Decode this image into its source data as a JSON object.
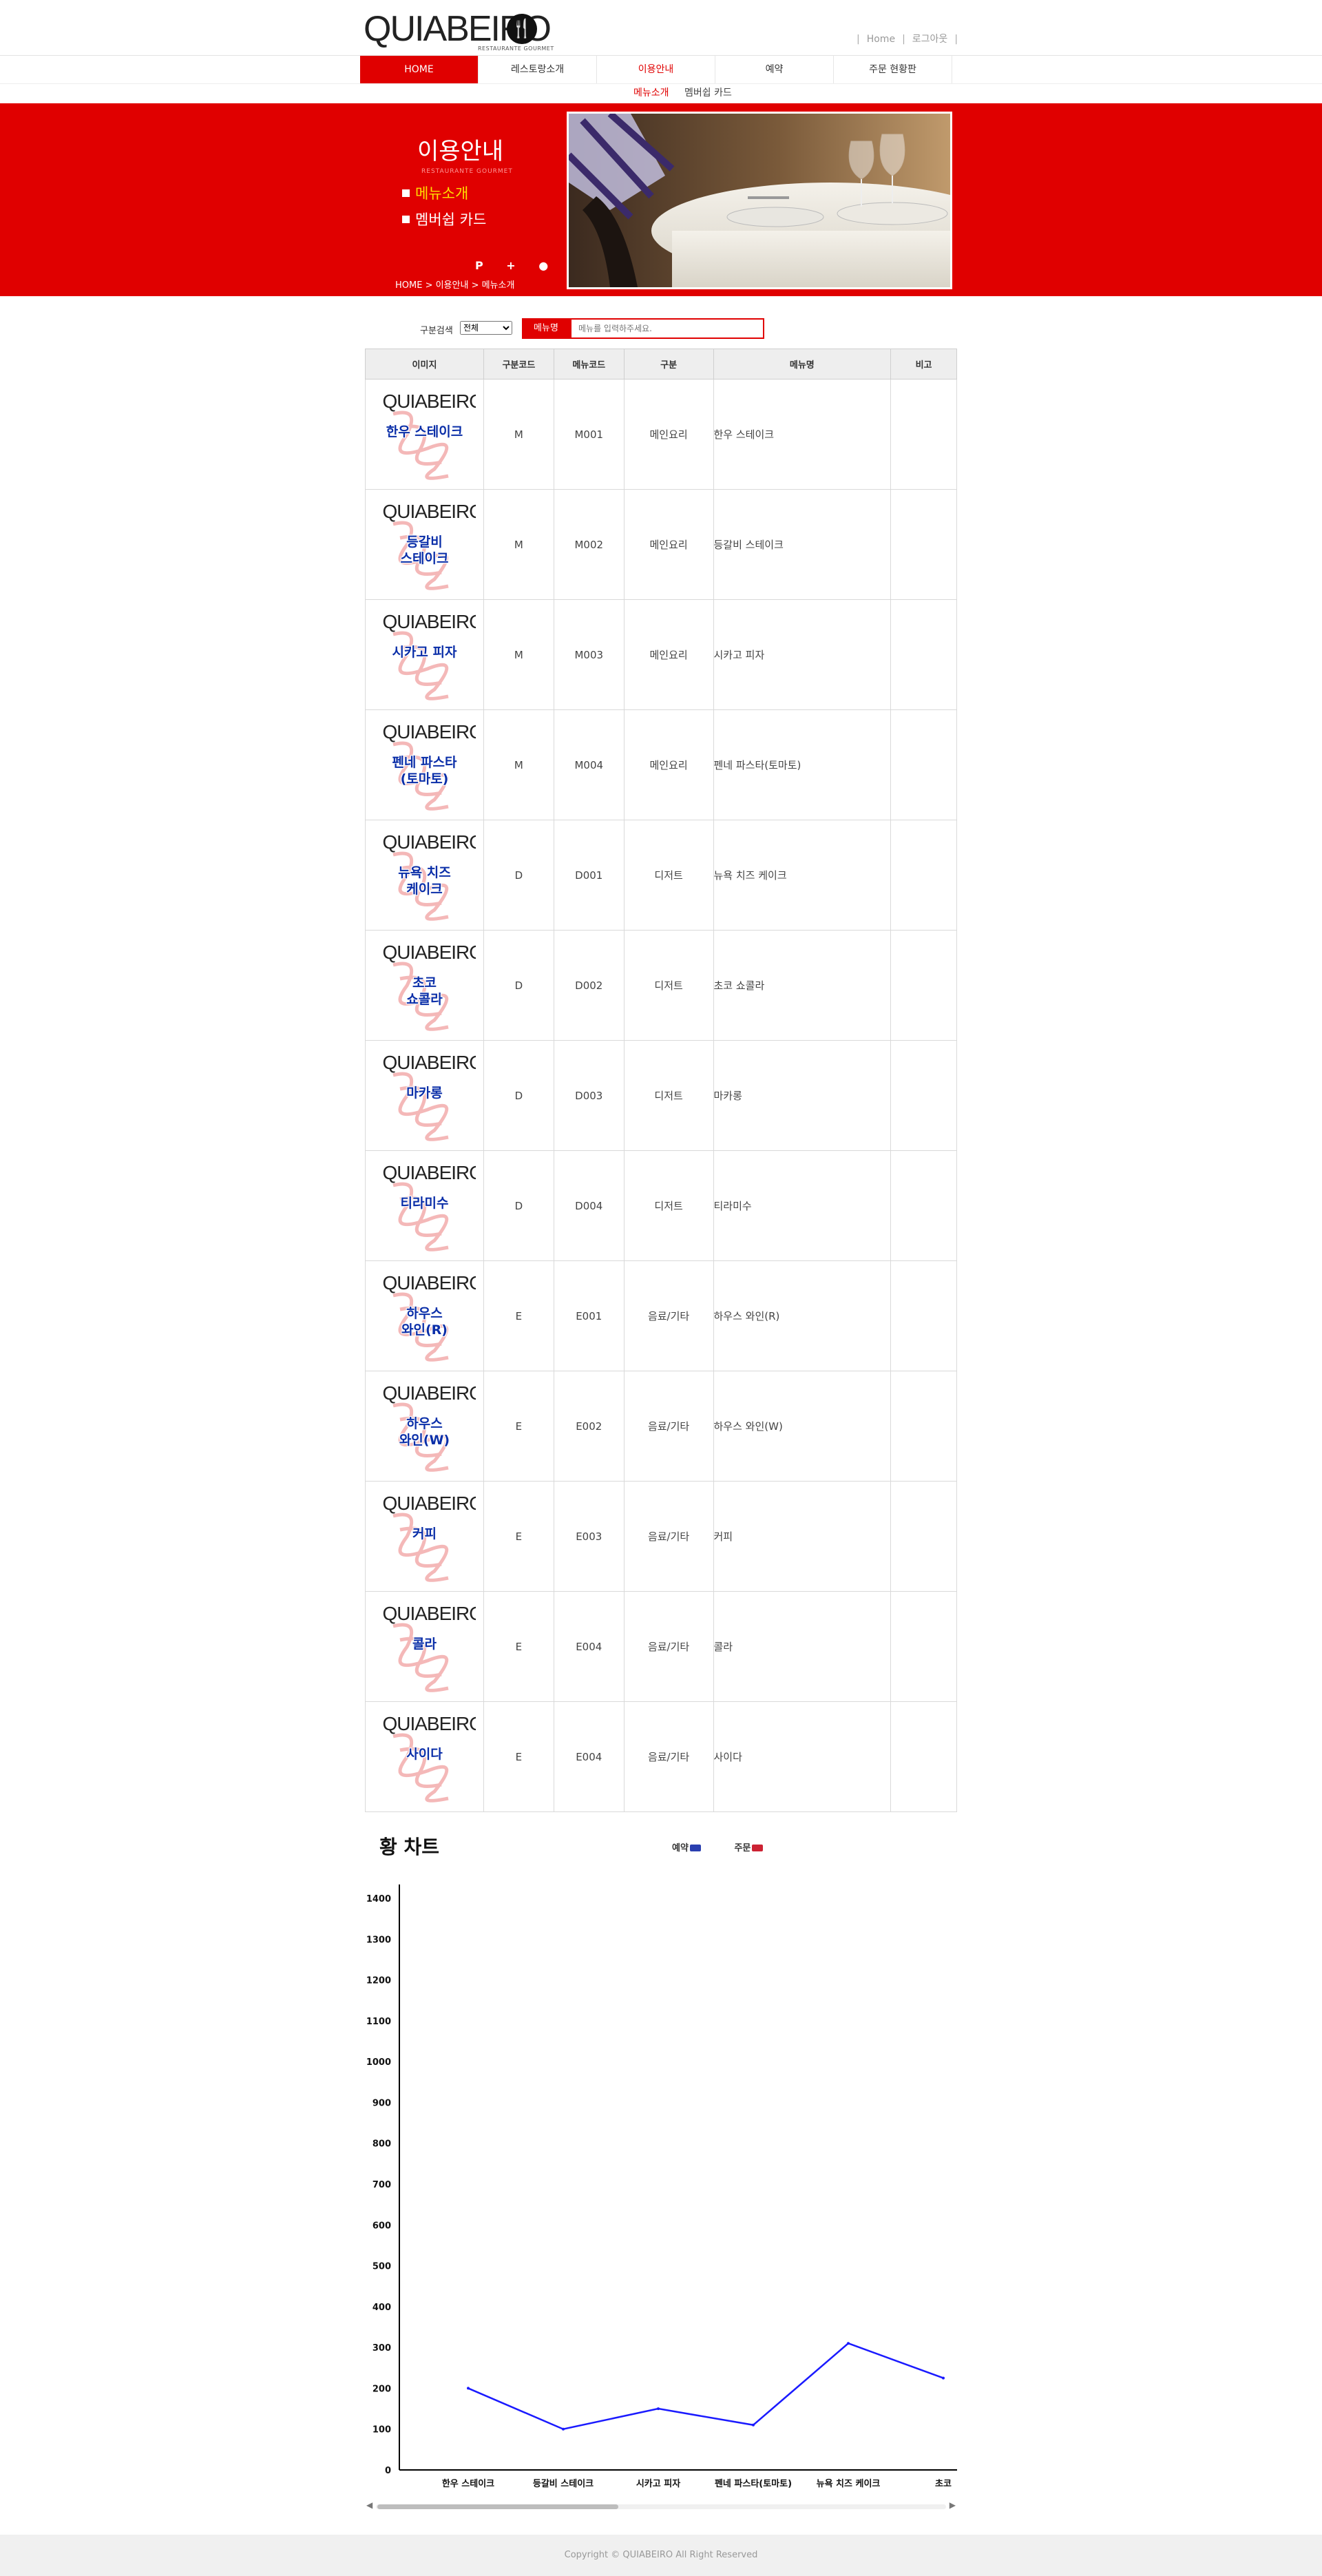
{
  "header": {
    "logo_text": "QUIABEIRO",
    "logo_sub": "RESTAURANTE GOURMET",
    "util_home": "Home",
    "util_login": "로그아웃"
  },
  "gnb": [
    "HOME",
    "레스토랑소개",
    "이용안내",
    "예약",
    "주문 현황판"
  ],
  "subnav": [
    "메뉴소개",
    "멤버쉽 카드"
  ],
  "hero": {
    "title": "이용안내",
    "subtitle": "RESTAURANTE GOURMET",
    "menu": [
      "메뉴소개",
      "멤버쉽 카드"
    ],
    "slider_controls": "P + ● −",
    "breadcrumb": "HOME > 이용안내 > 메뉴소개"
  },
  "search": {
    "label": "구분검색",
    "select_value": "전체",
    "field_label": "메뉴명",
    "placeholder": "메뉴를 입력하주세요."
  },
  "table": {
    "headers": [
      "이미지",
      "구분코드",
      "메뉴코드",
      "구분",
      "메뉴명",
      "비고"
    ],
    "rows": [
      {
        "img_label": "한우 스테이크",
        "type_code": "M",
        "menu_code": "M001",
        "category": "메인요리",
        "name": "한우 스테이크",
        "note": ""
      },
      {
        "img_label": "등갈비\n스테이크",
        "type_code": "M",
        "menu_code": "M002",
        "category": "메인요리",
        "name": "등갈비 스테이크",
        "note": ""
      },
      {
        "img_label": "시카고 피자",
        "type_code": "M",
        "menu_code": "M003",
        "category": "메인요리",
        "name": "시카고 피자",
        "note": ""
      },
      {
        "img_label": "펜네 파스타\n(토마토)",
        "type_code": "M",
        "menu_code": "M004",
        "category": "메인요리",
        "name": "펜네 파스타(토마토)",
        "note": ""
      },
      {
        "img_label": "뉴욕 치즈\n케이크",
        "type_code": "D",
        "menu_code": "D001",
        "category": "디저트",
        "name": "뉴욕 치즈 케이크",
        "note": ""
      },
      {
        "img_label": "초코\n쇼콜라",
        "type_code": "D",
        "menu_code": "D002",
        "category": "디저트",
        "name": "초코 쇼콜라",
        "note": ""
      },
      {
        "img_label": "마카롱",
        "type_code": "D",
        "menu_code": "D003",
        "category": "디저트",
        "name": "마카롱",
        "note": ""
      },
      {
        "img_label": "티라미수",
        "type_code": "D",
        "menu_code": "D004",
        "category": "디저트",
        "name": "티라미수",
        "note": ""
      },
      {
        "img_label": "하우스\n와인(R)",
        "type_code": "E",
        "menu_code": "E001",
        "category": "음료/기타",
        "name": "하우스 와인(R)",
        "note": ""
      },
      {
        "img_label": "하우스\n와인(W)",
        "type_code": "E",
        "menu_code": "E002",
        "category": "음료/기타",
        "name": "하우스 와인(W)",
        "note": ""
      },
      {
        "img_label": "커피",
        "type_code": "E",
        "menu_code": "E003",
        "category": "음료/기타",
        "name": "커피",
        "note": ""
      },
      {
        "img_label": "콜라",
        "type_code": "E",
        "menu_code": "E004",
        "category": "음료/기타",
        "name": "콜라",
        "note": ""
      },
      {
        "img_label": "사이다",
        "type_code": "E",
        "menu_code": "E004",
        "category": "음료/기타",
        "name": "사이다",
        "note": ""
      }
    ]
  },
  "chart_data": {
    "type": "line",
    "title": "황 차트",
    "legend": [
      "예약",
      "주문"
    ],
    "legend_colors": [
      "#2a3fb0",
      "#cc2233"
    ],
    "categories": [
      "한우 스테이크",
      "등갈비 스테이크",
      "시카고 피자",
      "펜네 파스타(토마토)",
      "뉴욕 치즈 케이크",
      "초코"
    ],
    "series": [
      {
        "name": "예약",
        "color": "#1a1aff",
        "values": [
          200,
          100,
          150,
          110,
          310,
          225
        ]
      }
    ],
    "yticks": [
      0,
      100,
      200,
      300,
      400,
      500,
      600,
      700,
      800,
      900,
      1000,
      1100,
      1200,
      1300,
      1400
    ],
    "ylim": [
      0,
      1400
    ],
    "grid": false
  },
  "footer": {
    "copyright": "Copyright © QUIABEIRO All Right Reserved"
  }
}
